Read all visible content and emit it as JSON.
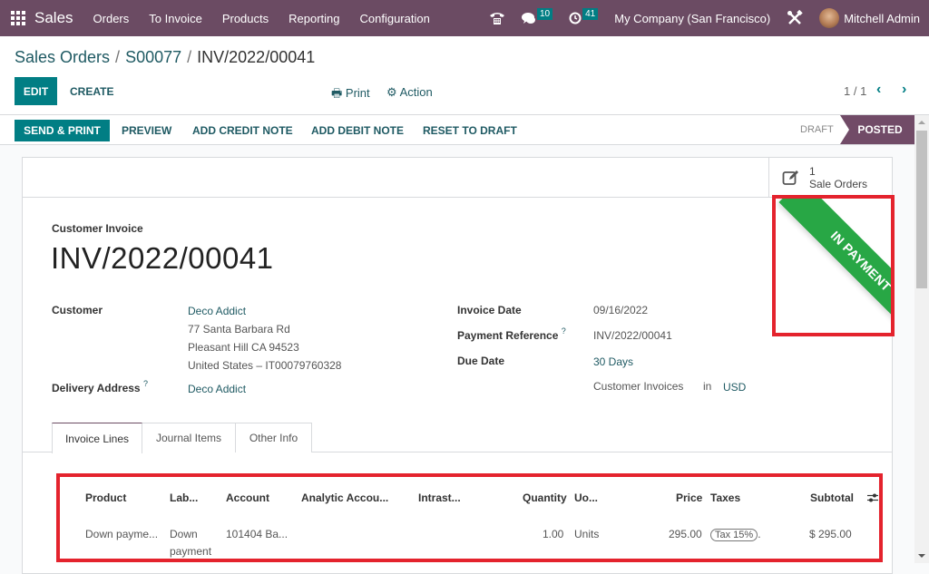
{
  "navbar": {
    "app_name": "Sales",
    "menu": [
      "Orders",
      "To Invoice",
      "Products",
      "Reporting",
      "Configuration"
    ],
    "messages_count": "10",
    "activities_count": "41",
    "company": "My Company (San Francisco)",
    "user": "Mitchell Admin",
    "icons": [
      "apps-grid-icon",
      "phone-icon",
      "chat-icon",
      "clock-icon",
      "tools-icon",
      "avatar"
    ]
  },
  "breadcrumb": {
    "items": [
      "Sales Orders",
      "S00077",
      "INV/2022/00041"
    ],
    "separator": "/"
  },
  "control_panel": {
    "edit_label": "EDIT",
    "create_label": "CREATE",
    "print_label": "Print",
    "action_label": "Action",
    "pager": "1 / 1"
  },
  "statusbar": {
    "buttons": [
      "SEND & PRINT",
      "PREVIEW",
      "ADD CREDIT NOTE",
      "ADD DEBIT NOTE",
      "RESET TO DRAFT"
    ],
    "stages": [
      "DRAFT",
      "POSTED"
    ],
    "current_stage": "POSTED"
  },
  "smart_button": {
    "count": "1",
    "label": "Sale Orders"
  },
  "ribbon": {
    "text": "IN PAYMENT",
    "color": "#28a745"
  },
  "form": {
    "doc_type": "Customer Invoice",
    "doc_name": "INV/2022/00041",
    "customer_label": "Customer",
    "customer_name": "Deco Addict",
    "customer_address": [
      "77 Santa Barbara Rd",
      "Pleasant Hill CA 94523",
      "United States – IT00079760328"
    ],
    "delivery_label": "Delivery Address",
    "delivery_value": "Deco Addict",
    "help_mark": "?",
    "invoice_date_label": "Invoice Date",
    "invoice_date": "09/16/2022",
    "payment_ref_label": "Payment Reference",
    "payment_ref": "INV/2022/00041",
    "due_date_label": "Due Date",
    "due_date": "30 Days",
    "journal": "Customer Invoices",
    "journal_in": "in",
    "currency": "USD"
  },
  "tabs": [
    "Invoice Lines",
    "Journal Items",
    "Other Info"
  ],
  "active_tab": "Invoice Lines",
  "invoice_lines": {
    "columns": [
      "Product",
      "Lab...",
      "Account",
      "Analytic Accou...",
      "Intrast...",
      "Quantity",
      "Uo...",
      "Price",
      "Taxes",
      "Subtotal"
    ],
    "rows": [
      {
        "product": "Down payme...",
        "label_line1": "Down",
        "label_line2": "payment",
        "account": "101404 Ba...",
        "analytic": "",
        "intrastat": "",
        "quantity": "1.00",
        "uom": "Units",
        "price": "295.00",
        "taxes": "Tax 15%",
        "taxes_suffix": ".",
        "subtotal": "$ 295.00"
      }
    ]
  },
  "colors": {
    "navbar": "#6b4b63",
    "primary": "#017e84",
    "link": "#1f5a63",
    "stage_active": "#714b67",
    "highlight": "#e4232d"
  }
}
